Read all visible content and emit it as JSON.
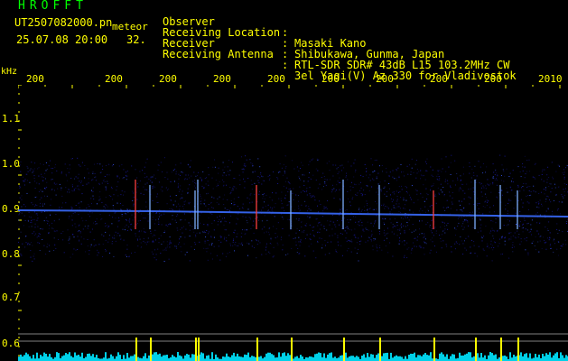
{
  "header": {
    "brand": "HROFFT",
    "filename": "UT2507082000.pn",
    "meteor_label": "meteor",
    "date_time": "25.07.08 20:00",
    "count": "32.",
    "meta": [
      {
        "key": "Observer",
        "sep": ":",
        "value": "Masaki Kano"
      },
      {
        "key": "Receiving Location",
        "sep": ":",
        "value": "Shibukawa, Gunma, Japan"
      },
      {
        "key": "Receiver",
        "sep": ":",
        "value": "RTL-SDR SDR# 43dB L15 103.2MHz CW"
      },
      {
        "key": "Receiving Antenna",
        "sep": ":",
        "value": "3el Yagi(V) Az 330 for Vladivostok"
      }
    ]
  },
  "axis": {
    "y_unit": "kHz",
    "x_ticks": [
      "200",
      "200",
      "200",
      "200",
      "200",
      "200",
      "200",
      "200",
      "200",
      "2010"
    ],
    "y_ticks": [
      "1.1",
      "1.0",
      "0.9",
      "0.8",
      "0.7",
      "0.6"
    ]
  },
  "colors": {
    "text_yellow": "#ffff00",
    "text_green": "#00ff00",
    "background": "#000000",
    "signal_line": "#3a6cff",
    "noise": "#1a1aa0",
    "tick": "#ffff00",
    "lower_bars": "#00d0e8"
  }
}
